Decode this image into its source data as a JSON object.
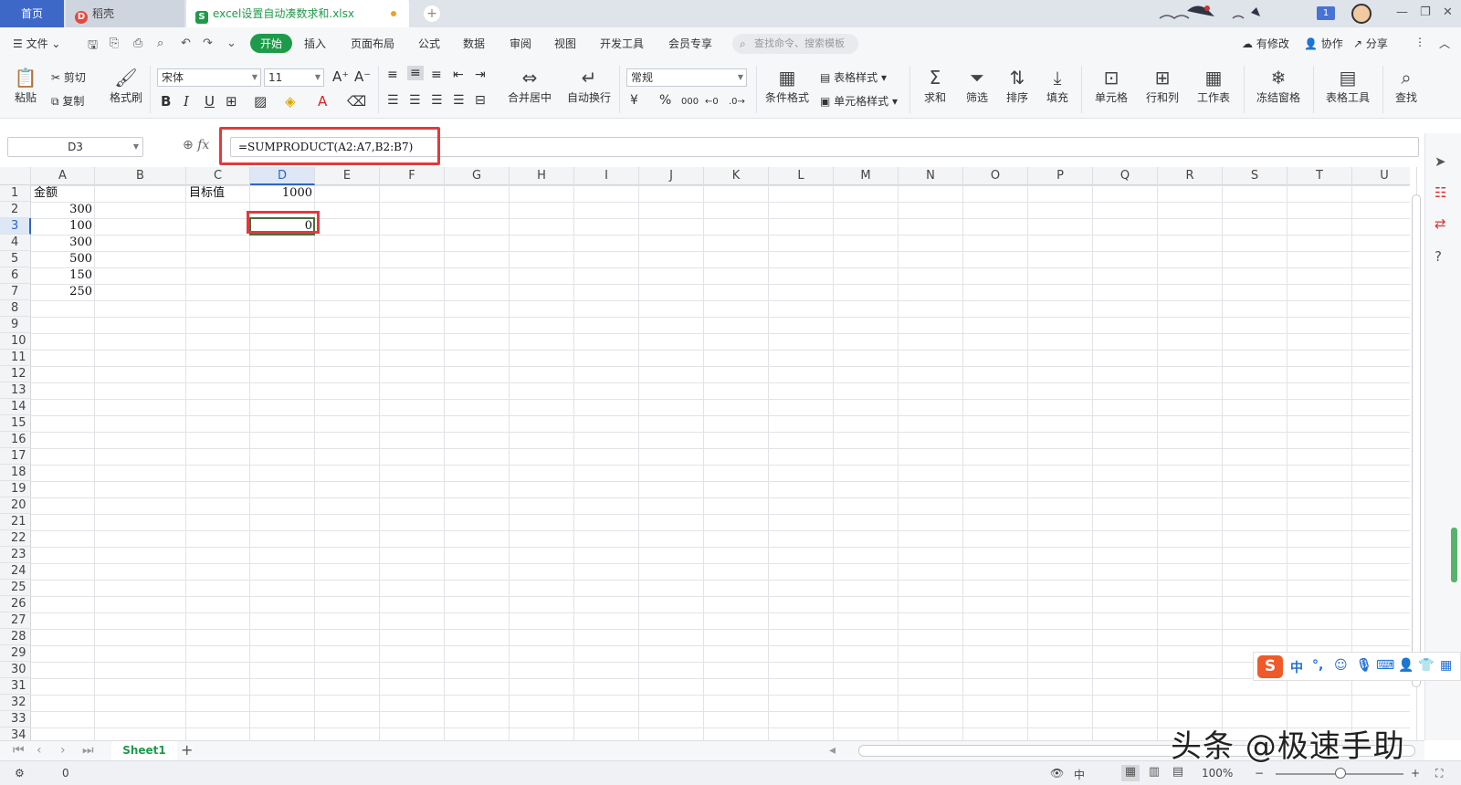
{
  "tabs": {
    "home": "首页",
    "daoke": "稻壳",
    "file": "excel设置自动凑数求和.xlsx",
    "file_icon": "S",
    "daoke_icon": "D"
  },
  "window": {
    "badge": "1"
  },
  "menu": {
    "file": "文件",
    "items": [
      "开始",
      "插入",
      "页面布局",
      "公式",
      "数据",
      "审阅",
      "视图",
      "开发工具",
      "会员专享"
    ],
    "search_placeholder": "查找命令、搜索模板",
    "modified": "有修改",
    "collab": "协作",
    "share": "分享"
  },
  "ribbon": {
    "paste": "粘贴",
    "cut": "剪切",
    "copy": "复制",
    "format_painter": "格式刷",
    "font_name": "宋体",
    "font_size": "11",
    "bold": "B",
    "italic": "I",
    "underline": "U",
    "merge_center": "合并居中",
    "wrap_text": "自动换行",
    "number_format": "常规",
    "currency": "¥",
    "percent": "%",
    "thousands": "000",
    "cond_format": "条件格式",
    "table_style": "表格样式",
    "cell_style": "单元格样式",
    "sum": "求和",
    "filter": "筛选",
    "sort": "排序",
    "fill": "填充",
    "cells": "单元格",
    "rows_cols": "行和列",
    "worksheet": "工作表",
    "freeze": "冻结窗格",
    "table_tools": "表格工具",
    "find": "查找"
  },
  "formula_bar": {
    "name_box": "D3",
    "fx_label": "fx",
    "formula": "=SUMPRODUCT(A2:A7,B2:B7)"
  },
  "sheet": {
    "columns": [
      "A",
      "B",
      "C",
      "D",
      "E",
      "F",
      "G",
      "H",
      "I",
      "J",
      "K",
      "L",
      "M",
      "N",
      "O",
      "P",
      "Q",
      "R",
      "S",
      "T",
      "U"
    ],
    "rows": [
      "1",
      "2",
      "3",
      "4",
      "5",
      "6",
      "7",
      "8",
      "9",
      "10",
      "11",
      "12",
      "13",
      "14",
      "15",
      "16",
      "17",
      "18",
      "19",
      "20",
      "21",
      "22",
      "23",
      "24",
      "25",
      "26",
      "27",
      "28",
      "29",
      "30",
      "31",
      "32",
      "33",
      "34"
    ],
    "selected_col": "D",
    "selected_row": "3",
    "cells": {
      "A1": "金额",
      "A2": "300",
      "A3": "100",
      "A4": "300",
      "A5": "500",
      "A6": "150",
      "A7": "250",
      "C1": "目标值",
      "D1": "1000",
      "D3": "0"
    }
  },
  "ime": {
    "logo": "S",
    "lang": "中",
    "punct": "°,"
  },
  "sheet_tabs": {
    "active": "Sheet1"
  },
  "status": {
    "value": "0",
    "zoom": "100%"
  },
  "watermark": "头条 @极速手助"
}
